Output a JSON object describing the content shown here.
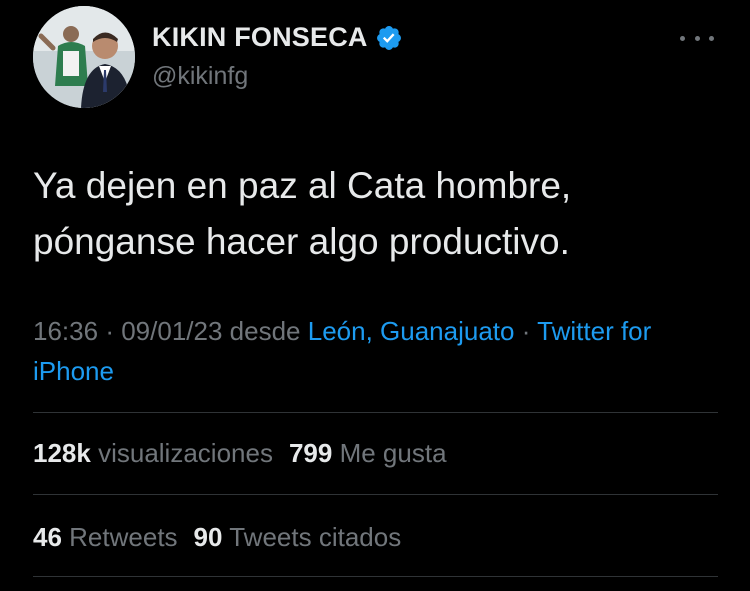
{
  "tweet": {
    "display_name": "KIKIN FONSECA",
    "handle": "@kikinfg",
    "verified": true,
    "text_line1": "Ya dejen en paz al Cata hombre,",
    "text_line2": "pónganse hacer algo productivo.",
    "time": "16:36",
    "date": "09/01/23",
    "from_word": "desde",
    "location": "León, Guanajuato",
    "client": "Twitter for iPhone",
    "separator": "·"
  },
  "stats": {
    "views_count": "128k",
    "views_label": "visualizaciones",
    "likes_count": "799",
    "likes_label": "Me gusta",
    "retweets_count": "46",
    "retweets_label": "Retweets",
    "quotes_count": "90",
    "quotes_label": "Tweets citados"
  },
  "colors": {
    "background": "#000000",
    "text": "#e7e9ea",
    "secondary": "#71767b",
    "link": "#1d9bf0",
    "divider": "#2f3336"
  },
  "icons": [
    "verified-badge-icon",
    "more-options-icon"
  ]
}
